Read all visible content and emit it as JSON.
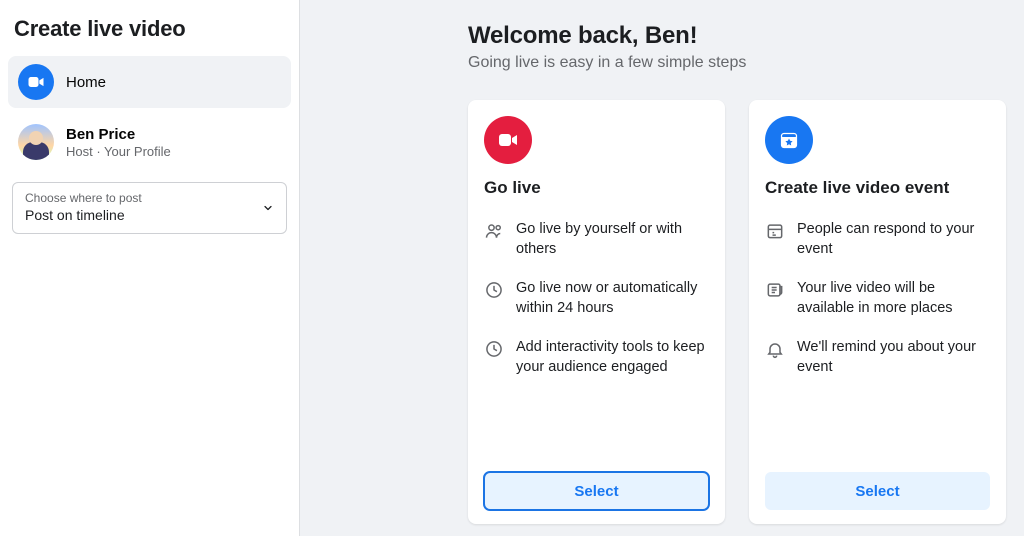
{
  "sidebar": {
    "title": "Create live video",
    "home_label": "Home",
    "profile": {
      "name": "Ben Price",
      "role": "Host · Your Profile"
    },
    "post_target": {
      "hint": "Choose where to post",
      "value": "Post on timeline"
    }
  },
  "welcome": {
    "title": "Welcome back, Ben!",
    "subtitle": "Going live is easy in a few simple steps"
  },
  "cards": {
    "go_live": {
      "title": "Go live",
      "features": [
        "Go live by yourself or with others",
        "Go live now or automatically within 24 hours",
        "Add interactivity tools to keep your audience engaged"
      ],
      "select_label": "Select"
    },
    "event": {
      "title": "Create live video event",
      "features": [
        "People can respond to your event",
        "Your live video will be available in more places",
        "We'll remind you about your event"
      ],
      "select_label": "Select"
    }
  }
}
